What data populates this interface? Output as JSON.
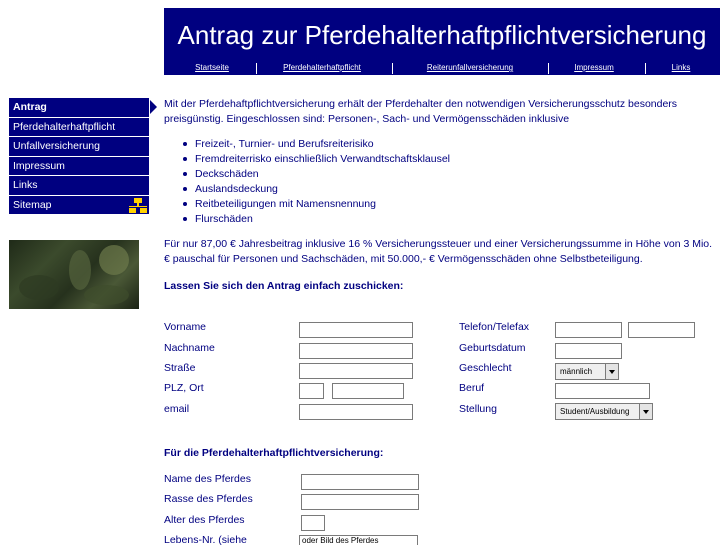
{
  "header": {
    "title": "Antrag zur Pferdehalterhaftpflichtversicherung",
    "nav": [
      "Startseite",
      "Pferdehalterhaftpflicht",
      "Reiterunfallversicherung",
      "Impressum",
      "Links"
    ]
  },
  "sidebar": {
    "items": [
      "Antrag",
      "Pferdehalterhaftpflicht",
      "Unfallversicherung",
      "Impressum",
      "Links",
      "Sitemap"
    ],
    "active": "Antrag",
    "sitemap_icon": "sitemap-icon"
  },
  "colors": {
    "primary": "#000080",
    "text": "#000080",
    "icon": "#ffd200",
    "background": "#ffffff"
  },
  "main": {
    "intro": "Mit der Pferdehaftpflichtversicherung erhält der Pferdehalter den notwendigen Versicherungsschutz besonders preisgünstig. Eingeschlossen sind: Personen-, Sach- und Vermögensschäden inklusive",
    "features": [
      "Freizeit-, Turnier- und Berufsreiterisiko",
      "Fremdreiterrisko einschließlich Verwandtschaftsklausel",
      "Deckschäden",
      "Auslandsdeckung",
      "Reitbeteiligungen mit Namensnennung",
      "Flurschäden"
    ],
    "price": "Für nur 87,00 € Jahresbeitrag inklusive 16 % Versicherungssteuer und einer Versicherungssumme in Höhe von 3 Mio. € pauschal für Personen und Sachschäden, mit 50.000,- € Vermögensschäden ohne Selbstbeteiligung.",
    "send_heading": "Lassen Sie sich den Antrag einfach zuschicken:",
    "horse_heading": "Für die Pferdehalterhaftpflichtversicherung:"
  },
  "form": {
    "vorname": {
      "label": "Vorname",
      "value": ""
    },
    "nachname": {
      "label": "Nachname",
      "value": ""
    },
    "strasse": {
      "label": "Straße",
      "value": ""
    },
    "plz_ort": {
      "label": "PLZ, Ort",
      "plz": "",
      "ort": ""
    },
    "email": {
      "label": "email",
      "value": ""
    },
    "telefon": {
      "label": "Telefon/Telefax",
      "telefon": "",
      "telefax": ""
    },
    "geburtsdatum": {
      "label": "Geburtsdatum",
      "value": ""
    },
    "geschlecht": {
      "label": "Geschlecht",
      "value": "männlich"
    },
    "beruf": {
      "label": "Beruf",
      "value": ""
    },
    "stellung": {
      "label": "Stellung",
      "value": "Student/Ausbildung"
    }
  },
  "horse_form": {
    "name": {
      "label": "Name des Pferdes",
      "value": ""
    },
    "rasse": {
      "label": "Rasse des Pferdes",
      "value": ""
    },
    "alter": {
      "label": "Alter des Pferdes",
      "value": ""
    },
    "lebensnr": {
      "label": "Lebens-Nr. (siehe",
      "value": "oder Bild des Pferdes"
    }
  }
}
